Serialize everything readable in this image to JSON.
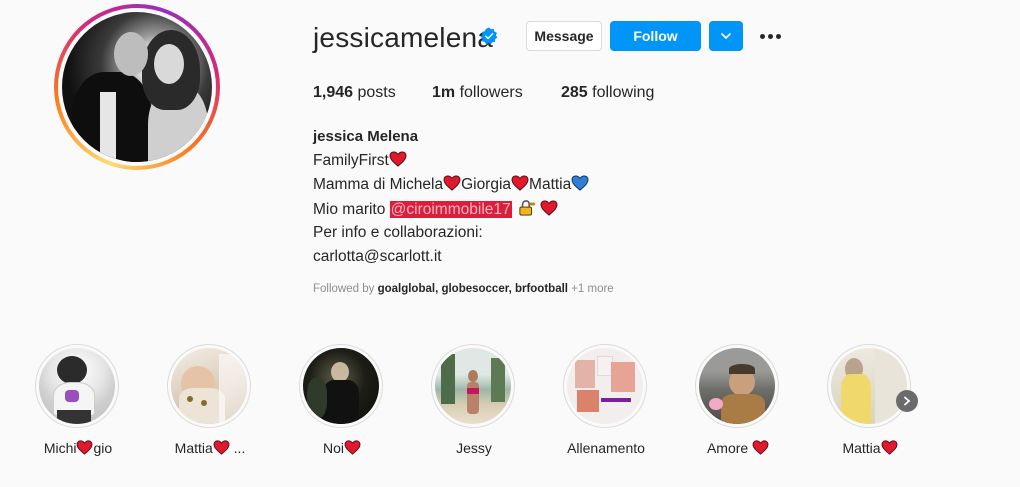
{
  "profile": {
    "username": "jessicamelena",
    "message_label": "Message",
    "follow_label": "Follow",
    "posts_count": "1,946",
    "posts_label": "posts",
    "followers_count": "1m",
    "followers_label": "followers",
    "following_count": "285",
    "following_label": "following"
  },
  "bio": {
    "name": "jessica Melena",
    "line1": "FamilyFirst",
    "line2_a": "Mamma di Michela",
    "line2_b": "Giorgia",
    "line2_c": "Mattia",
    "line3_a": "Mio marito ",
    "line3_mention": "@ciroimmobile17",
    "line4": "Per info e collaborazioni:",
    "line5": "carlotta@scarlott.it"
  },
  "followed_by": {
    "prefix": "Followed by ",
    "users": "goalglobal, globesoccer, brfootball",
    "more": "+1 more"
  },
  "highlights": [
    {
      "label_a": "Michi",
      "label_b": "gio"
    },
    {
      "label_a": "Mattia",
      "label_b": " ..."
    },
    {
      "label_a": "Noi",
      "label_b": ""
    },
    {
      "label_a": "Jessy",
      "label_b": ""
    },
    {
      "label_a": "Allenamento",
      "label_b": ""
    },
    {
      "label_a": "Amore ",
      "label_b": ""
    },
    {
      "label_a": "Mattia",
      "label_b": ""
    }
  ],
  "colors": {
    "accent": "#0095f6",
    "heart_red": "#e0192e",
    "heart_blue": "#2f7fd6",
    "mention_bg": "#dc1e3c"
  },
  "icons": [
    "verified-badge-icon",
    "chevron-down-icon",
    "more-options-icon",
    "red-heart-icon",
    "blue-heart-icon",
    "lock-key-icon",
    "chevron-right-icon"
  ]
}
